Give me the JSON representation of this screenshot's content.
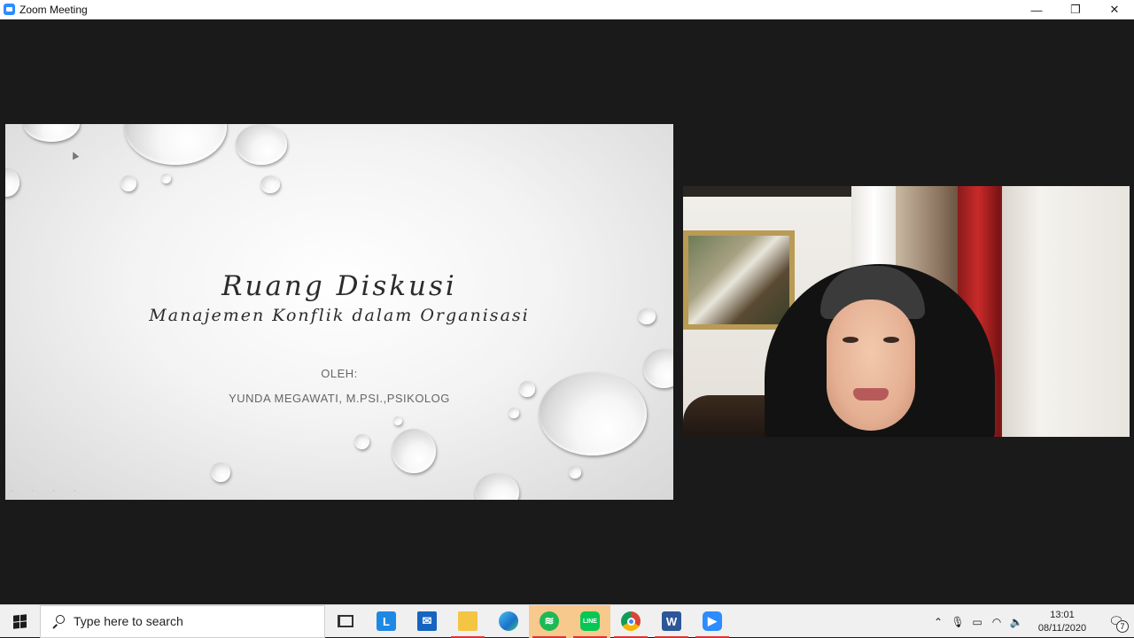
{
  "window": {
    "title": "Zoom Meeting",
    "minimize_glyph": "—",
    "restore_glyph": "❐",
    "close_glyph": "✕"
  },
  "slide": {
    "title": "Ruang Diskusi",
    "subtitle": "Manajemen Konflik dalam Organisasi",
    "by_label": "OLEH:",
    "presenter": "YUNDA MEGAWATI, M.PSI.,PSIKOLOG",
    "background_color": "#f3f3f3"
  },
  "participant_video": {
    "icon": "webcam-video"
  },
  "taskbar": {
    "search_placeholder": "Type here to search",
    "apps": [
      {
        "name": "task-view",
        "icon": "task-view-icon"
      },
      {
        "name": "l-app",
        "icon": "l-app-icon",
        "glyph": "L"
      },
      {
        "name": "mail",
        "icon": "mail-icon",
        "glyph": "✉"
      },
      {
        "name": "file-explorer",
        "icon": "folder-icon",
        "glyph": ""
      },
      {
        "name": "edge",
        "icon": "edge-icon",
        "glyph": ""
      },
      {
        "name": "spotify",
        "icon": "spotify-icon",
        "glyph": "≋"
      },
      {
        "name": "line",
        "icon": "line-icon",
        "glyph": "LINE"
      },
      {
        "name": "chrome",
        "icon": "chrome-icon",
        "glyph": ""
      },
      {
        "name": "word",
        "icon": "word-icon",
        "glyph": "W"
      },
      {
        "name": "zoom",
        "icon": "zoom-icon",
        "glyph": "▶"
      }
    ],
    "tray": {
      "chevron": "⌃",
      "mic": "🎙",
      "battery": "▭",
      "wifi": "◠",
      "volume": "🔈"
    },
    "clock": {
      "time": "13:01",
      "date": "08/11/2020"
    },
    "notification_count": "7",
    "accent_color": "#d33"
  }
}
